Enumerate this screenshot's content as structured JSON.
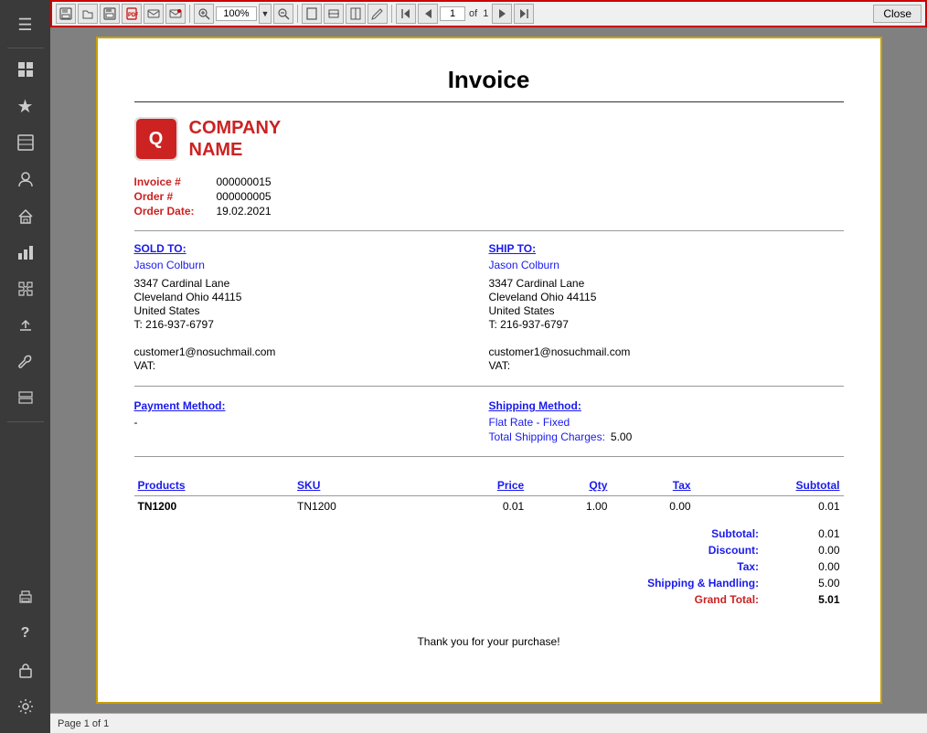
{
  "sidebar": {
    "icons": [
      {
        "name": "hamburger-menu-icon",
        "symbol": "☰"
      },
      {
        "name": "dashboard-icon",
        "symbol": "▦"
      },
      {
        "name": "star-icon",
        "symbol": "★"
      },
      {
        "name": "box-icon",
        "symbol": "🗄"
      },
      {
        "name": "user-icon",
        "symbol": "👤"
      },
      {
        "name": "home-icon",
        "symbol": "🏠"
      },
      {
        "name": "chart-icon",
        "symbol": "📊"
      },
      {
        "name": "puzzle-icon",
        "symbol": "🧩"
      },
      {
        "name": "upload-icon",
        "symbol": "⬆"
      },
      {
        "name": "wrench-icon",
        "symbol": "🔧"
      },
      {
        "name": "layers-icon",
        "symbol": "▤"
      },
      {
        "name": "print-icon",
        "symbol": "🖨"
      },
      {
        "name": "question-icon",
        "symbol": "?"
      },
      {
        "name": "lock-icon",
        "symbol": "🔒"
      },
      {
        "name": "gear-icon",
        "symbol": "⚙"
      }
    ]
  },
  "toolbar": {
    "zoom": "100%",
    "zoom_dropdown": "▼",
    "page_current": "1",
    "page_total": "1",
    "page_of_label": "of",
    "close_label": "Close",
    "buttons": [
      {
        "name": "save-icon",
        "symbol": "💾"
      },
      {
        "name": "open-icon",
        "symbol": "📁"
      },
      {
        "name": "save2-icon",
        "symbol": "🖫"
      },
      {
        "name": "pdf-icon",
        "symbol": "📄"
      },
      {
        "name": "email-icon",
        "symbol": "✉"
      },
      {
        "name": "email2-icon",
        "symbol": "📧"
      },
      {
        "name": "zoom-in-icon",
        "symbol": "🔍"
      },
      {
        "name": "zoom-out-icon",
        "symbol": "🔎"
      },
      {
        "name": "page-view-icon",
        "symbol": "▭"
      },
      {
        "name": "fit-width-icon",
        "symbol": "↔"
      },
      {
        "name": "fit-page-icon",
        "symbol": "↕"
      },
      {
        "name": "edit-icon",
        "symbol": "✏"
      },
      {
        "name": "first-page-icon",
        "symbol": "⏮"
      },
      {
        "name": "prev-page-icon",
        "symbol": "◀"
      },
      {
        "name": "next-page-icon",
        "symbol": "▶"
      },
      {
        "name": "last-page-icon",
        "symbol": "⏭"
      }
    ]
  },
  "invoice": {
    "title": "Invoice",
    "company": {
      "name_line1": "COMPANY",
      "name_line2": "NAME",
      "logo_letter": "Q"
    },
    "details": {
      "invoice_label": "Invoice #",
      "invoice_value": "000000015",
      "order_label": "Order #",
      "order_value": "000000005",
      "date_label": "Order Date:",
      "date_value": "19.02.2021"
    },
    "sold_to": {
      "heading": "SOLD TO:",
      "name": "Jason Colburn",
      "address1": "3347 Cardinal Lane",
      "address2": "Cleveland Ohio 44115",
      "country": "United States",
      "phone": "T: 216-937-6797",
      "email": "customer1@nosuchmail.com",
      "vat_label": "VAT:"
    },
    "ship_to": {
      "heading": "SHIP TO:",
      "name": "Jason Colburn",
      "address1": "3347 Cardinal Lane",
      "address2": "Cleveland Ohio 44115",
      "country": "United States",
      "phone": "T: 216-937-6797",
      "email": "customer1@nosuchmail.com",
      "vat_label": "VAT:"
    },
    "payment": {
      "heading": "Payment Method:",
      "value": "-"
    },
    "shipping": {
      "heading": "Shipping Method:",
      "method": "Flat Rate - Fixed",
      "charges_label": "Total Shipping Charges:",
      "charges_value": "5.00"
    },
    "table": {
      "col_product": "Products",
      "col_sku": "SKU",
      "col_price": "Price",
      "col_qty": "Qty",
      "col_tax": "Tax",
      "col_subtotal": "Subtotal",
      "rows": [
        {
          "product": "TN1200",
          "sku": "TN1200",
          "price": "0.01",
          "qty": "1.00",
          "tax": "0.00",
          "subtotal": "0.01"
        }
      ]
    },
    "totals": {
      "subtotal_label": "Subtotal:",
      "subtotal_value": "0.01",
      "discount_label": "Discount:",
      "discount_value": "0.00",
      "tax_label": "Tax:",
      "tax_value": "0.00",
      "shipping_label": "Shipping & Handling:",
      "shipping_value": "5.00",
      "grand_label": "Grand Total:",
      "grand_value": "5.01"
    },
    "footer": "Thank you for your purchase!"
  },
  "statusbar": {
    "text": "Page 1 of 1"
  }
}
